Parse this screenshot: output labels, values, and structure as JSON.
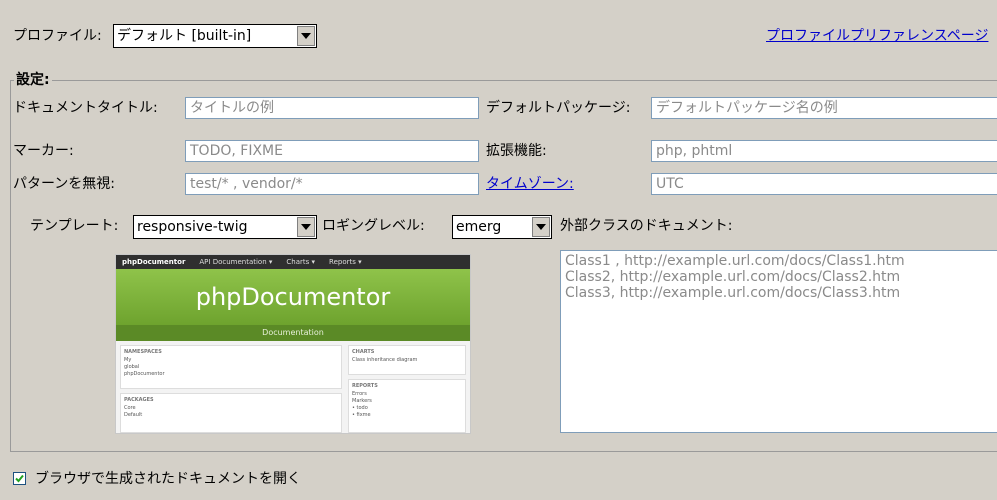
{
  "profile": {
    "label": "プロファイル:",
    "value": "デフォルト [built-in]",
    "prefs_link": "プロファイルプリファレンスページ"
  },
  "settings": {
    "title": "設定:",
    "doc_title_label": "ドキュメントタイトル:",
    "doc_title_placeholder": "タイトルの例",
    "default_package_label": "デフォルトパッケージ:",
    "default_package_placeholder": "デフォルトパッケージ名の例",
    "marker_label": "マーカー:",
    "marker_placeholder": "TODO, FIXME",
    "extensions_label": "拡張機能:",
    "extensions_placeholder": "php, phtml",
    "ignore_label": "パターンを無視:",
    "ignore_placeholder": "test/* , vendor/*",
    "timezone_link": "タイムゾーン:",
    "timezone_placeholder": "UTC",
    "template_label": "テンプレート:",
    "template_value": "responsive-twig",
    "logging_label": "ロギングレベル:",
    "logging_value": "emerg",
    "external_docs_label": "外部クラスのドキュメント:",
    "external_docs_value": "Class1 , http://example.url.com/docs/Class1.htm\nClass2, http://example.url.com/docs/Class2.htm\nClass3, http://example.url.com/docs/Class3.htm"
  },
  "preview": {
    "nav_brand": "phpDocumentor",
    "nav_items": [
      "API Documentation ▾",
      "Charts ▾",
      "Reports ▾"
    ],
    "hero_title": "phpDocumentor",
    "hero_sub": "Documentation",
    "namespaces_title": "NAMESPACES",
    "namespaces": [
      "My",
      "global",
      "phpDocumentor"
    ],
    "packages_title": "PACKAGES",
    "packages": [
      "Core",
      "Default"
    ],
    "charts_title": "CHARTS",
    "charts": [
      "Class inheritance diagram"
    ],
    "reports_title": "REPORTS",
    "reports": [
      "Errors",
      "Markers",
      "• todo",
      "• fixme"
    ]
  },
  "open_browser": {
    "checked": true,
    "label": "ブラウザで生成されたドキュメントを開く"
  }
}
